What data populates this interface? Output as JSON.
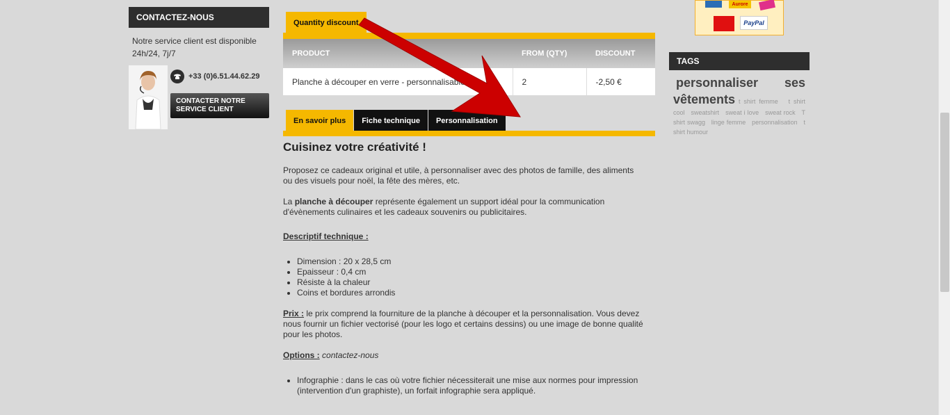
{
  "contact": {
    "title": "CONTACTEZ-NOUS",
    "text": "Notre service client est disponible 24h/24, 7j/7",
    "phone": "+33 (0)6.51.44.62.29",
    "button_label": "CONTACTER NOTRE SERVICE CLIENT"
  },
  "quantity_discount": {
    "tab_label": "Quantity discount",
    "headers": [
      "PRODUCT",
      "FROM (QTY)",
      "DISCOUNT"
    ],
    "rows": [
      {
        "product": "Planche à découper en verre - personnalisable",
        "qty": "2",
        "discount": "-2,50 €"
      }
    ]
  },
  "tabs": [
    "En savoir plus",
    "Fiche technique",
    "Personnalisation"
  ],
  "content": {
    "heading": "Cuisinez votre créativité !",
    "para1": "Proposez ce cadeaux original et utile, à personnaliser avec des photos de famille, des aliments ou des visuels pour noël, la fête des mères, etc.",
    "para2_prefix": "La ",
    "para2_bold": "planche à découper",
    "para2_rest": " représente également un support idéal pour la communication d'évènements culinaires et les cadeaux souvenirs ou publicitaires.",
    "tech_title": "Descriptif technique :",
    "specs": [
      "Dimension : 20 x 28,5 cm",
      "Epaisseur : 0,4 cm",
      "Résiste à la chaleur",
      "Coins et bordures arrondis"
    ],
    "price_label": "Prix :",
    "price_text": " le prix comprend la fourniture de la planche à découper et la personnalisation. Vous devez nous fournir un fichier vectorisé (pour les logo et certains dessins) ou une image de bonne qualité pour les photos.",
    "options_label": "Options :",
    "options_text": "contactez-nous",
    "options_list": [
      "Infographie : dans le cas où votre fichier nécessiterait une mise aux normes pour impression (intervention d'un graphiste), un forfait infographie sera appliqué."
    ]
  },
  "payment": {
    "logos": [
      "Aurore",
      "PayPal"
    ]
  },
  "tags": {
    "title": "TAGS",
    "big": [
      "personnaliser",
      "ses",
      "vêtements"
    ],
    "small": [
      "t shirt femme",
      "t shirt cool",
      "sweatshirt",
      "sweat i love",
      "sweat rock",
      "T shirt swagg",
      "linge femme",
      "personnalisation",
      "t shirt humour"
    ]
  },
  "colors": {
    "accent": "#f5b800",
    "dark": "#2e2e2e",
    "arrow": "#cc0000"
  }
}
